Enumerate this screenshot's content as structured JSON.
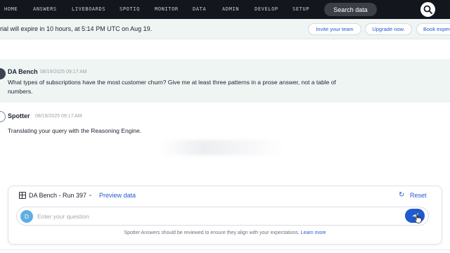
{
  "nav": {
    "items": [
      "HOME",
      "ANSWERS",
      "LIVEBOARDS",
      "SPOTIQ",
      "MONITOR",
      "DATA",
      "ADMIN",
      "DEVELOP",
      "SETUP"
    ],
    "search_label": "Search data",
    "search_icon": "search-icon"
  },
  "banner": {
    "text": "rial will expire in 10 hours, at 5:14 PM UTC on Aug 19.",
    "invite_label": "Invite your team",
    "upgrade_label": "Upgrade now.",
    "book_label": "Book exper"
  },
  "conversation": {
    "user": {
      "author": "DA Bench",
      "timestamp": "08/19/2025 09:17 AM",
      "text_line1": "What types of subscriptions have the most customer churn? Give me at least three patterns in a prose answer, not a table of",
      "text_line2": "numbers."
    },
    "assistant": {
      "author": "Spotter",
      "timestamp": "08/19/2025 09:17 AM",
      "text": "Translating your query with the Reasoning Engine."
    }
  },
  "panel": {
    "datasource": "DA Bench - Run 397",
    "preview_label": "Preview data",
    "reset_label": "Reset",
    "avatar_letter": "D",
    "input_placeholder": "Enter your question",
    "input_value": "",
    "footnote": "Spotter Answers should be reviewed to ensure they align with your expectations.",
    "learn_more": "Learn more"
  },
  "colors": {
    "nav_bg": "#14161d",
    "banner_bg": "#eef5f3",
    "accent": "#2359d1",
    "send_button": "#1f5bcf",
    "avatar_d": "#5faee3"
  }
}
